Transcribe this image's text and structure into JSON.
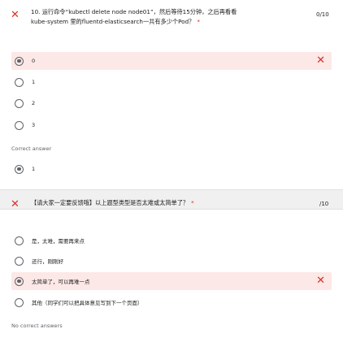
{
  "question1": {
    "line1": "10. 运行命令“kubectl delete node node01”，然后等待15分钟，之后再看看",
    "line2": "kube-system 里的fluentd-elasticsearch一共有多少个Pod？",
    "required_mark": "*",
    "score": "0/10",
    "options": [
      {
        "label": "0",
        "selected": true,
        "incorrect": true
      },
      {
        "label": "1",
        "selected": false,
        "incorrect": false
      },
      {
        "label": "2",
        "selected": false,
        "incorrect": false
      },
      {
        "label": "3",
        "selected": false,
        "incorrect": false
      }
    ],
    "correct_answer_label": "Correct answer",
    "correct_answer": "1"
  },
  "question2": {
    "text": "【请大家一定要反馈哦】以上题型类型是否太难或太简单了？",
    "required_mark": "*",
    "score": "/10",
    "options": [
      {
        "label": "是，太难，需要再来点",
        "selected": false,
        "incorrect": false
      },
      {
        "label": "还行，刚刚好",
        "selected": false,
        "incorrect": false
      },
      {
        "label": "太简单了，可以再难一点",
        "selected": true,
        "incorrect": true
      },
      {
        "label": "其他（同学们可以把具体意见写到下一个页面）",
        "selected": false,
        "incorrect": false
      }
    ],
    "no_correct_label": "No correct answers"
  },
  "colors": {
    "error_red": "#d93025",
    "wrong_bg": "#fce8e6",
    "radio_gray": "#5f6368",
    "divider_bg": "#f0f0f0"
  }
}
